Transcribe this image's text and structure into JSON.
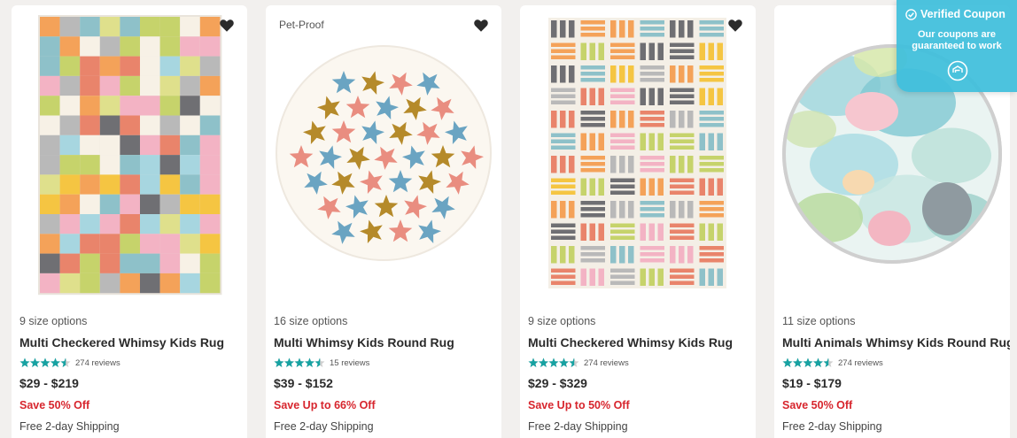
{
  "coupon": {
    "title": "Verified Coupon",
    "line1": "Our coupons are",
    "line2": "guaranteed to work",
    "icon": "check-circle-icon",
    "action_icon": "hand-icon",
    "color": "#3ebedb"
  },
  "colors": {
    "sale": "#d7252d",
    "star": "#17a2a2",
    "heart": "#2b2b2b"
  },
  "products": [
    {
      "badge": "",
      "sizes": "9 size options",
      "title": "Multi Checkered Whimsy Kids Rug",
      "rating": 4.5,
      "reviews": "274 reviews",
      "price": "$29 - $219",
      "sale": "Save 50% Off",
      "shipping": "Free 2-day Shipping"
    },
    {
      "badge": "Pet-Proof",
      "sizes": "16 size options",
      "title": "Multi Whimsy Kids Round Rug",
      "rating": 4.5,
      "reviews": "15 reviews",
      "price": "$39 - $152",
      "sale": "Save Up to 66% Off",
      "shipping": "Free 2-day Shipping"
    },
    {
      "badge": "",
      "sizes": "9 size options",
      "title": "Multi Checkered Whimsy Kids Rug",
      "rating": 4.5,
      "reviews": "274 reviews",
      "price": "$29 - $329",
      "sale": "Save Up to 50% Off",
      "shipping": "Free 2-day Shipping"
    },
    {
      "badge": "",
      "sizes": "11 size options",
      "title": "Multi Animals Whimsy Kids Round Rug",
      "rating": 4.5,
      "reviews": "274 reviews",
      "price": "$19 - $179",
      "sale": "Save 50% Off",
      "shipping": "Free 2-day Shipping"
    }
  ]
}
